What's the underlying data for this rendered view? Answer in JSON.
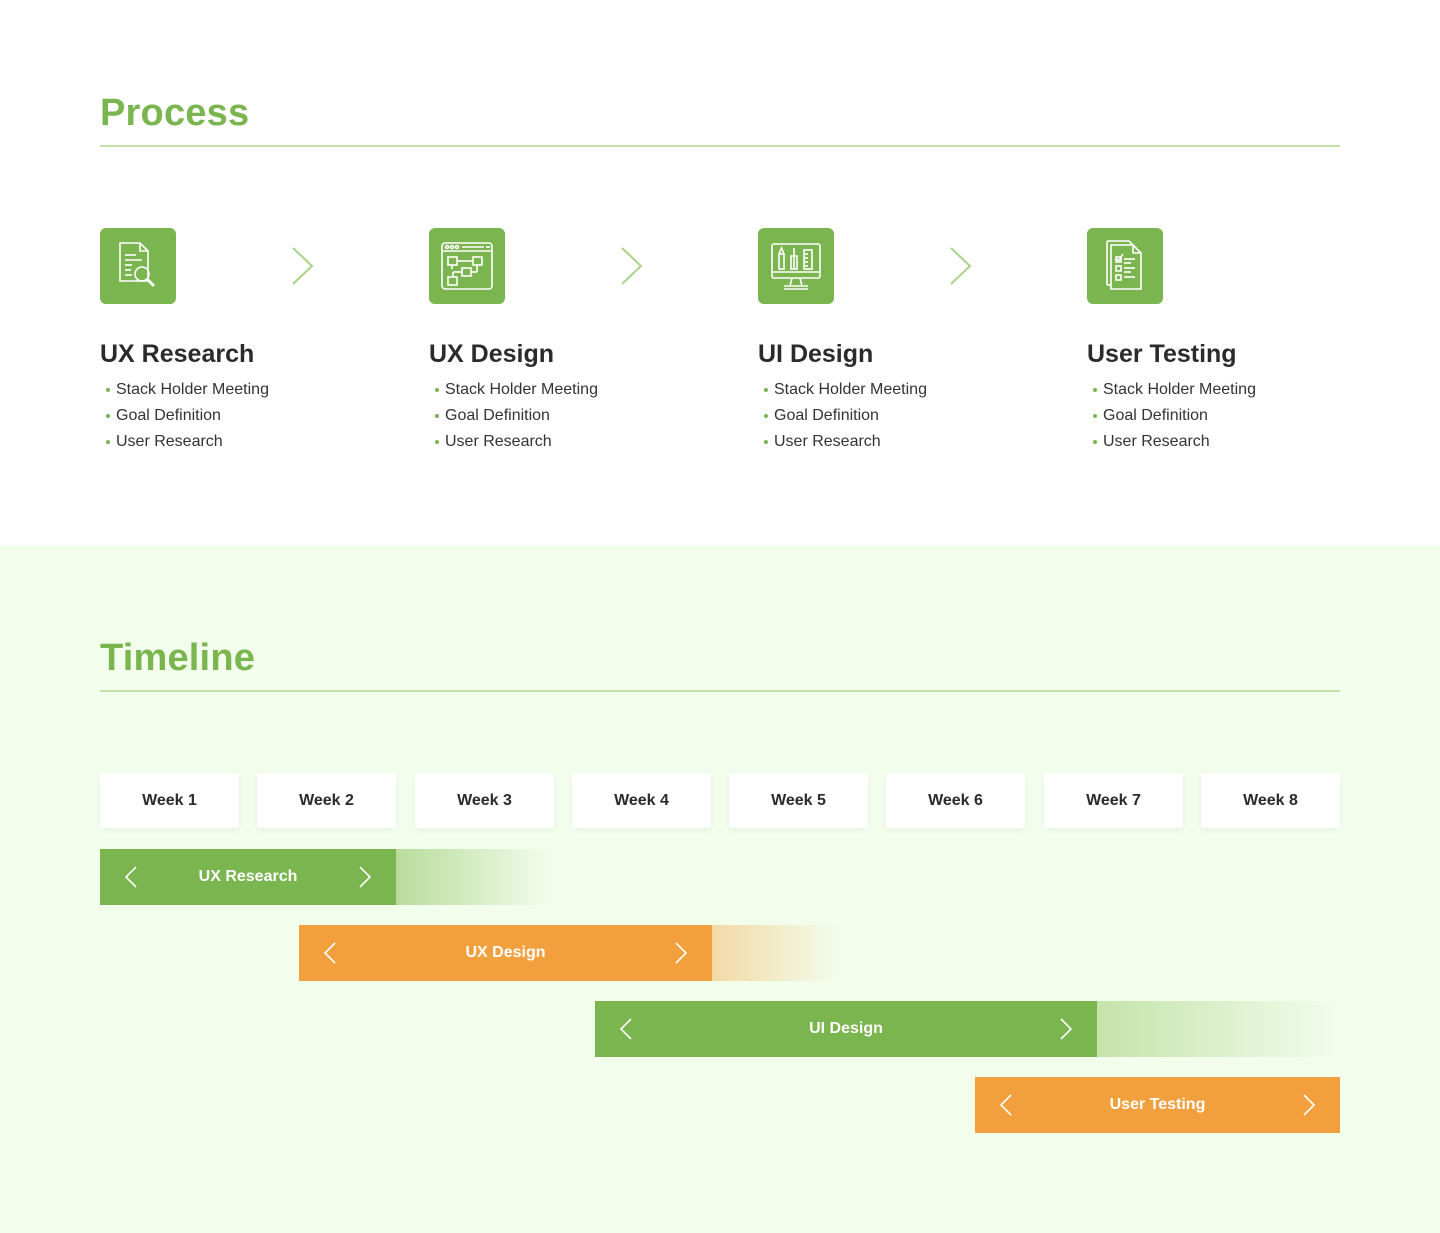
{
  "process": {
    "title": "Process",
    "steps": [
      {
        "title": "UX Research",
        "icon": "document-search-icon",
        "items": [
          "Stack Holder Meeting",
          "Goal Definition",
          "User Research"
        ]
      },
      {
        "title": "UX Design",
        "icon": "wireframe-flow-icon",
        "items": [
          "Stack Holder Meeting",
          "Goal Definition",
          "User Research"
        ]
      },
      {
        "title": "UI Design",
        "icon": "design-tools-monitor-icon",
        "items": [
          "Stack Holder Meeting",
          "Goal Definition",
          "User Research"
        ]
      },
      {
        "title": "User Testing",
        "icon": "checklist-icon",
        "items": [
          "Stack Holder Meeting",
          "Goal Definition",
          "User Research"
        ]
      }
    ]
  },
  "timeline": {
    "title": "Timeline",
    "weeks": [
      "Week 1",
      "Week 2",
      "Week 3",
      "Week 4",
      "Week 5",
      "Week 6",
      "Week 7",
      "Week 8"
    ],
    "bars": [
      {
        "label": "UX Research",
        "color": "#7ab550"
      },
      {
        "label": "UX Design",
        "color": "#f2a03e"
      },
      {
        "label": "UI Design",
        "color": "#7ab550"
      },
      {
        "label": "User Testing",
        "color": "#f2a03e"
      }
    ]
  },
  "colors": {
    "accent_green": "#7ab550",
    "accent_orange": "#f2a03e",
    "timeline_background": "#f2fdec"
  }
}
